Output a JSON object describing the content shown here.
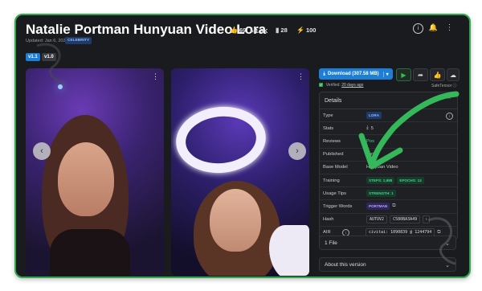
{
  "header": {
    "title": "Natalie Portman Hunyuan Video Lora",
    "stats": [
      {
        "icon": "thumbs-up-icon",
        "value": "69"
      },
      {
        "icon": "download-icon",
        "value": "1.3K"
      },
      {
        "icon": "bookmark-icon",
        "value": "28"
      },
      {
        "icon": "bolt-icon",
        "value": "100"
      }
    ],
    "updated": "Updated: Jan 6, 2025",
    "badge": "CELEBRITY"
  },
  "versions": [
    "v1.1",
    "v1.0"
  ],
  "actions": {
    "download_label": "Download (307.58 MB)",
    "verified_prefix": "Verified:",
    "verified_when": "20 days ago",
    "safetensor": "SafeTensor"
  },
  "details": {
    "heading": "Details",
    "rows": [
      {
        "key": "Type",
        "value": "LORA"
      },
      {
        "key": "Stats",
        "value": "5"
      },
      {
        "key": "Reviews",
        "value": "Pos"
      },
      {
        "key": "Published",
        "value": "Jan"
      },
      {
        "key": "Base Model",
        "value": "Hunyuan Video"
      },
      {
        "key": "Training",
        "steps": "STEPS: 2,988",
        "epochs": "EPOCHS: 13"
      },
      {
        "key": "Usage Tips",
        "value": "STRENGTH: 1"
      },
      {
        "key": "Trigger Words",
        "value": "PORTMAN"
      },
      {
        "key": "Hash",
        "algo": "AUTOV2",
        "value": "C580BA3A49"
      },
      {
        "key": "AIR",
        "value": "civitai: 1090839 @ 1244794"
      }
    ]
  },
  "sections": {
    "files": "1 File",
    "about": "About this version"
  },
  "colors": {
    "accent_blue": "#1c7ed6",
    "accent_green": "#2fa84f",
    "panel_bg": "#1a1b1e"
  }
}
